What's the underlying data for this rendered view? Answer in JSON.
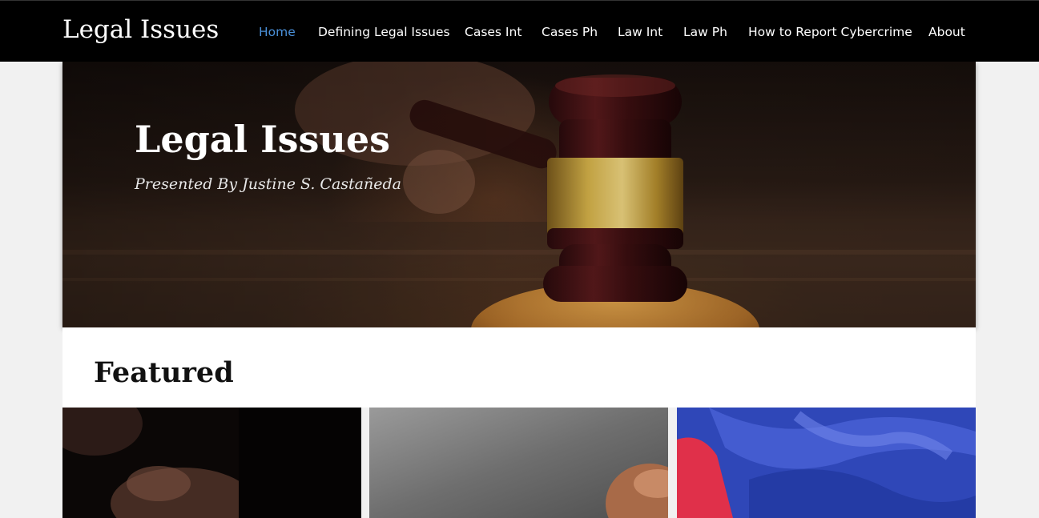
{
  "site": {
    "title": "Legal Issues"
  },
  "nav": {
    "items": [
      {
        "label": "Home",
        "active": true
      },
      {
        "label": "Defining Legal Issues",
        "active": false
      },
      {
        "label": "Cases Int",
        "active": false
      },
      {
        "label": "Cases Ph",
        "active": false
      },
      {
        "label": "Law Int",
        "active": false
      },
      {
        "label": "Law Ph",
        "active": false
      },
      {
        "label": "How to Report Cybercrime",
        "active": false
      },
      {
        "label": "About",
        "active": false
      }
    ]
  },
  "hero": {
    "title": "Legal Issues",
    "subtitle": "Presented By Justine S. Castañeda"
  },
  "featured": {
    "heading": "Featured"
  },
  "colors": {
    "topbar": "#000000",
    "nav_active": "#4a90d9",
    "page_background": "#f1f1f1"
  }
}
